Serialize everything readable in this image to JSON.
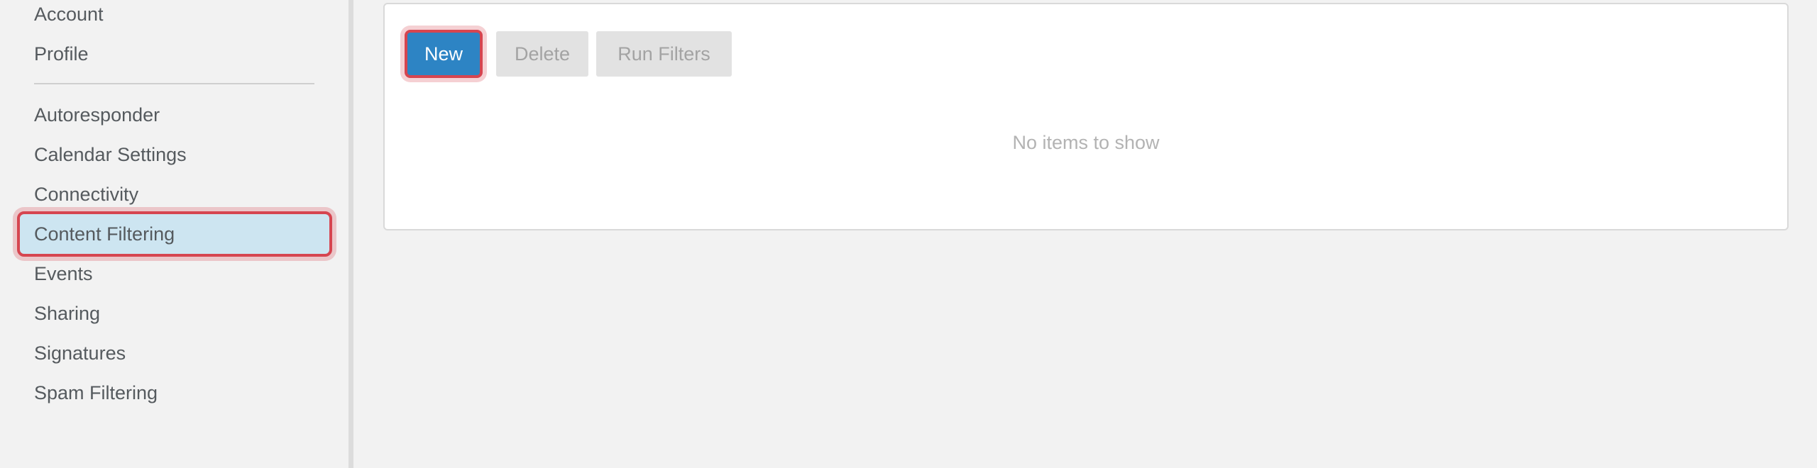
{
  "sidebar": {
    "items": [
      {
        "label": "Account"
      },
      {
        "label": "Profile"
      },
      {
        "label": "Autoresponder"
      },
      {
        "label": "Calendar Settings"
      },
      {
        "label": "Connectivity"
      },
      {
        "label": "Content Filtering",
        "selected": true
      },
      {
        "label": "Events"
      },
      {
        "label": "Sharing"
      },
      {
        "label": "Signatures"
      },
      {
        "label": "Spam Filtering"
      }
    ]
  },
  "toolbar": {
    "new_label": "New",
    "delete_label": "Delete",
    "run_filters_label": "Run Filters"
  },
  "content": {
    "empty_message": "No items to show"
  },
  "colors": {
    "accent": "#2d84c4",
    "selected_bg": "#cde5f1",
    "highlight": "#d64550"
  }
}
